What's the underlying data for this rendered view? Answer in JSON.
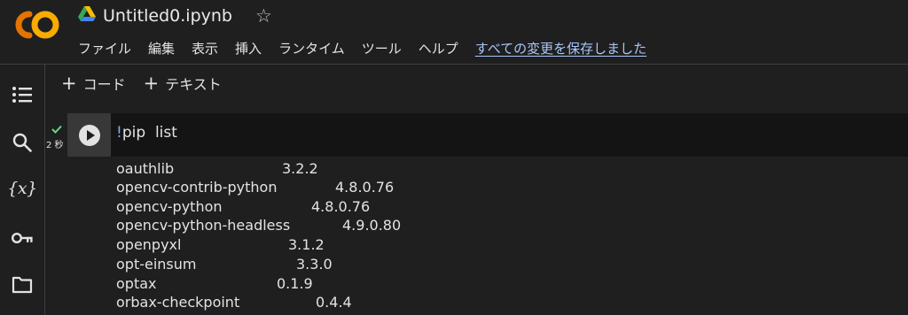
{
  "header": {
    "logo_text": "CO",
    "title": "Untitled0.ipynb",
    "menu": [
      "ファイル",
      "編集",
      "表示",
      "挿入",
      "ランタイム",
      "ツール",
      "ヘルプ"
    ],
    "save_status": "すべての変更を保存しました"
  },
  "sidebar": {
    "items": [
      {
        "icon": "table-of-contents-icon"
      },
      {
        "icon": "search-icon"
      },
      {
        "icon": "variables-icon",
        "label": "{x}"
      },
      {
        "icon": "key-icon"
      },
      {
        "icon": "folder-icon"
      }
    ]
  },
  "toolbar": {
    "code_label": "コード",
    "text_label": "テキスト",
    "plus": "+"
  },
  "cell": {
    "exec_time": "2 秒",
    "status": "success",
    "code_bang": "!",
    "code_text": "pip  list"
  },
  "output": {
    "rows": [
      {
        "name": "oauthlib",
        "version": "3.2.2"
      },
      {
        "name": "opencv-contrib-python",
        "version": "4.8.0.76"
      },
      {
        "name": "opencv-python",
        "version": "4.8.0.76"
      },
      {
        "name": "opencv-python-headless",
        "version": "4.9.0.80"
      },
      {
        "name": "openpyxl",
        "version": "3.1.2"
      },
      {
        "name": "opt-einsum",
        "version": "3.3.0"
      },
      {
        "name": "optax",
        "version": "0.1.9"
      },
      {
        "name": "orbax-checkpoint",
        "version": "0.4.4"
      }
    ]
  },
  "colors": {
    "background": "#1f1f1f",
    "code_background": "#141414",
    "accent_link": "#a8c7fa",
    "logo_orange": "#f9ab00",
    "logo_dark_orange": "#e37400",
    "success_green": "#6dd58c"
  }
}
